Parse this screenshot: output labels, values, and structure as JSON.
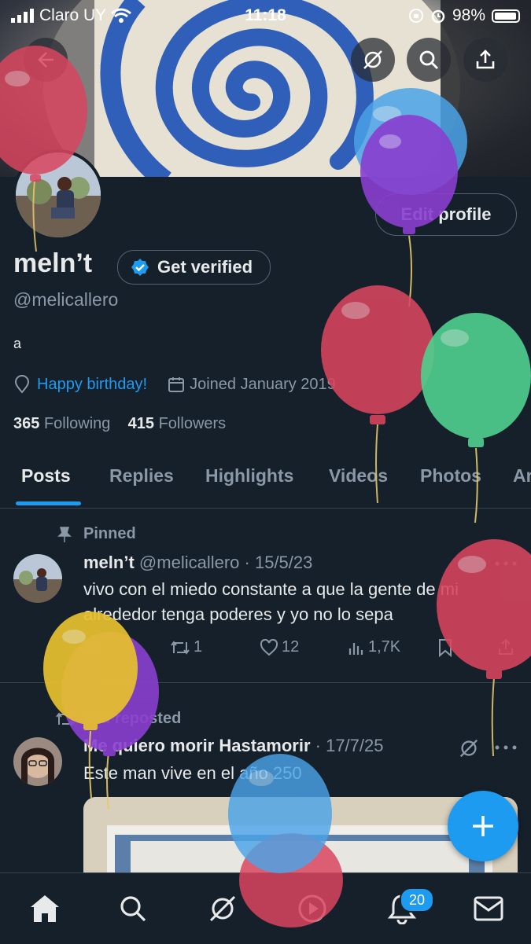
{
  "status_bar": {
    "carrier": "Claro UY",
    "time": "11:18",
    "battery": "98%"
  },
  "profile": {
    "name": "meln’t",
    "verify_label": "Get verified",
    "edit_label": "Edit profile",
    "handle": "@melicallero",
    "bio": "a",
    "location_link": "Happy birthday!",
    "joined": "Joined January 2019",
    "following_count": "365",
    "following_label": "Following",
    "followers_count": "415",
    "followers_label": "Followers"
  },
  "tabs": [
    {
      "label": "Posts",
      "active": true
    },
    {
      "label": "Replies"
    },
    {
      "label": "Highlights"
    },
    {
      "label": "Videos"
    },
    {
      "label": "Photos"
    },
    {
      "label": "Ar"
    }
  ],
  "pinned_tweet": {
    "pinned_label": "Pinned",
    "name": "meln’t",
    "handle": "@melicallero",
    "date": "15/5/23",
    "text": "vivo con el miedo constante a que la gente de mi alrededor tenga poderes y yo no lo sepa",
    "retweets": "1",
    "likes": "12",
    "views": "1,7K"
  },
  "repost_tweet": {
    "reposted_label": "You reposted",
    "name": "Me quiero morir Hastamorir",
    "date": "17/7/25",
    "text": "Este man vive en el año 250"
  },
  "bottom_nav": {
    "notifications_badge": "20"
  },
  "colors": {
    "background": "#15202b",
    "accent": "#1d9bf0",
    "muted": "#8b98a5"
  },
  "icons": [
    "back-arrow-icon",
    "grok-icon",
    "search-icon",
    "share-icon",
    "verified-check-icon",
    "location-pin-icon",
    "calendar-icon",
    "pin-icon",
    "reply-icon",
    "retweet-icon",
    "heart-icon",
    "views-icon",
    "bookmark-icon",
    "upload-icon",
    "more-icon",
    "compose-plus-icon",
    "home-icon",
    "play-icon",
    "bell-icon",
    "mail-icon"
  ]
}
